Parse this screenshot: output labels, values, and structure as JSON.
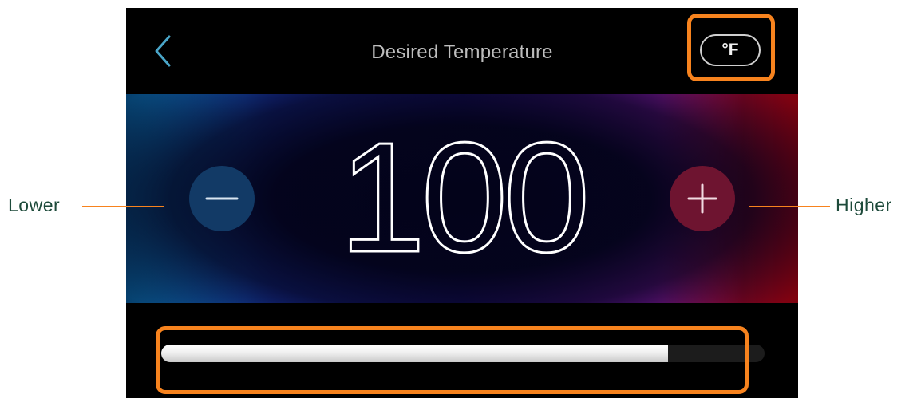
{
  "header": {
    "title": "Desired Temperature",
    "unit_label": "°F"
  },
  "setpoint": {
    "value": "100"
  },
  "slider": {
    "level_fraction": 0.84
  },
  "callouts": {
    "lower": "Lower",
    "higher": "Higher"
  },
  "colors": {
    "annotation": "#f7831e",
    "minus_button": "#123a66",
    "plus_button": "#6e1430",
    "back_arrow": "#4aa6c9"
  },
  "icons": {
    "back": "chevron-left-icon",
    "minus": "minus-icon",
    "plus": "plus-icon"
  }
}
